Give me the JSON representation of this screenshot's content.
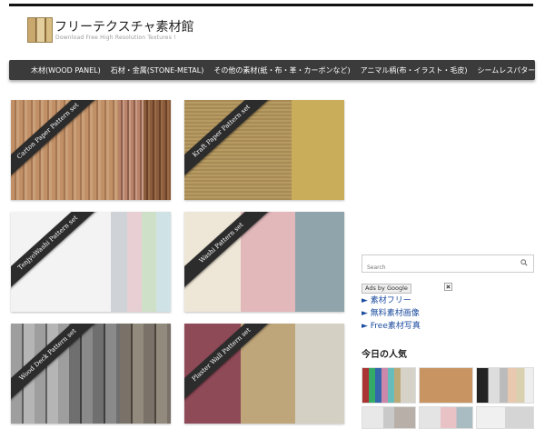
{
  "header": {
    "site_title": "フリーテクスチャ素材館",
    "tagline": "Download Free High Resolution Textures !"
  },
  "nav": {
    "items": [
      "木材(WOOD PANEL)",
      "石材・金属(STONE-METAL)",
      "その他の素材(紙・布・革・カーボンなど)",
      "アニマル柄(布・イラスト・毛皮)",
      "シームレスパターン"
    ]
  },
  "cards": [
    {
      "title": "Carton Paper Pattern set"
    },
    {
      "title": "Kraft Paper Pattern set"
    },
    {
      "title": "TenjyoWashi Pattern set"
    },
    {
      "title": "Washi Pattern set"
    },
    {
      "title": "Wood Deck Pattern set"
    },
    {
      "title": "Plaster Wall Pattern set"
    }
  ],
  "sidebar": {
    "search_placeholder": "Search",
    "ads_label": "Ads by Google",
    "ad_links": [
      "► 素材フリー",
      "► 無料素材画像",
      "► Free素材写真"
    ],
    "popular_title": "今日の人気"
  },
  "colors": {
    "nav_bg": "#3b3b3b",
    "link": "#1a4a9e",
    "banner": "#2c2c2c"
  }
}
